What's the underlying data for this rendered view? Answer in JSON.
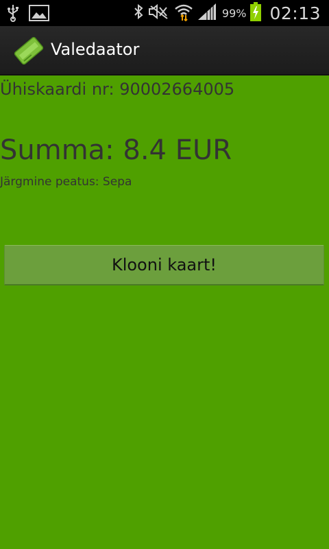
{
  "status_bar": {
    "icons": [
      "usb-icon",
      "image-icon",
      "bluetooth-icon",
      "mute-icon",
      "wifi-icon",
      "signal-icon",
      "battery-charging-icon"
    ],
    "battery": "99%",
    "time": "02:13"
  },
  "action_bar": {
    "title": "Valedaator",
    "icon": "card-icon"
  },
  "main": {
    "card_number": "Ühiskaardi nr: 90002664005",
    "sum": "Summa: 8.4 EUR",
    "next_stop": "Järgmine peatus: Sepa",
    "clone_button": "Klooni kaart!"
  },
  "colors": {
    "background": "#4fa000",
    "button": "#6c9f3d",
    "action_bar": "#222222"
  }
}
